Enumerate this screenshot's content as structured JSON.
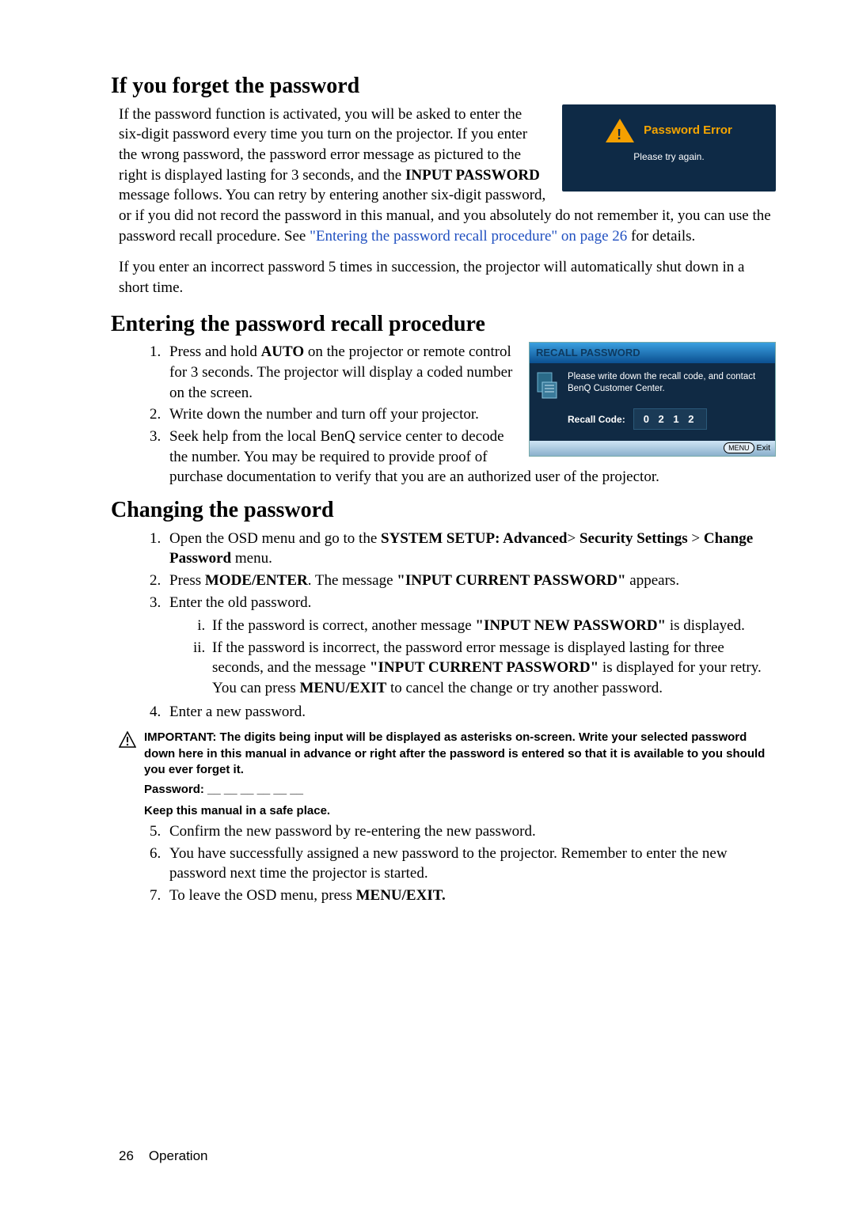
{
  "section1": {
    "heading": "If you forget the password",
    "para1a": "If the password function is activated, you will be asked to enter the six-digit password every time you turn on the projector. If you enter the wrong password, the password error message as pictured to the right is displayed lasting for 3 seconds, and the ",
    "para1b": "INPUT PASSWORD",
    "para1c": " message follows. You can retry by entering another six-digit password, or if you did not record the password in this manual, and you absolutely do not remember it, you can use the password recall procedure. See ",
    "link": "\"Entering the password recall procedure\" on page 26",
    "para1d": " for details.",
    "para2": "If you enter an incorrect password 5 times in succession, the projector will automatically shut down in a short time."
  },
  "err_box": {
    "title": "Password Error",
    "msg": "Please try again."
  },
  "section2": {
    "heading": "Entering the password recall procedure",
    "step1a": "Press and hold ",
    "step1b": "AUTO",
    "step1c": " on the projector or remote control for 3 seconds. The projector will display a coded number on the screen.",
    "step2": "Write down the number and turn off your projector.",
    "step3": "Seek help from the local BenQ service center to decode the number. You may be required to provide proof of purchase documentation to verify that you are an authorized user of the projector."
  },
  "recall_box": {
    "head": "RECALL PASSWORD",
    "text": "Please write down the recall code, and contact BenQ Customer Center.",
    "code_label": "Recall Code:",
    "code": "0 2 1 2",
    "foot_btn": "MENU",
    "foot_txt": "Exit"
  },
  "section3": {
    "heading": "Changing the password",
    "s1a": "Open the OSD menu and go to the ",
    "s1b": "SYSTEM SETUP: Advanced",
    "s1c": "> ",
    "s1d": "Security Settings",
    "s1e": " > ",
    "s1f": "Change Password",
    "s1g": " menu.",
    "s2a": "Press ",
    "s2b": "MODE/ENTER",
    "s2c": ". The message ",
    "s2d": "\"INPUT CURRENT PASSWORD\"",
    "s2e": " appears.",
    "s3": "Enter the old password.",
    "s3ia": "If the password is correct, another message ",
    "s3ib": "\"INPUT NEW PASSWORD\"",
    "s3ic": " is displayed.",
    "s3iia": "If the password is incorrect, the password error message is displayed lasting for three seconds, and the message ",
    "s3iib": "\"INPUT CURRENT PASSWORD\"",
    "s3iic": " is displayed for your retry. You can press ",
    "s3iid": "MENU/EXIT",
    "s3iie": " to cancel the change or try another password.",
    "s4": "Enter a new password.",
    "note": "IMPORTANT: The digits being input will be displayed as asterisks on-screen. Write your selected password down here in this manual in advance or right after the password is entered so that it is available to you should you ever forget it.",
    "pwd_line": "Password: __ __ __ __ __ __",
    "keep": "Keep this manual in a safe place.",
    "s5": "Confirm the new password by re-entering the new password.",
    "s6": "You have successfully assigned a new password to the projector. Remember to enter the new password next time the projector is started.",
    "s7a": "To leave the OSD menu, press ",
    "s7b": "MENU/EXIT."
  },
  "footer": {
    "page": "26",
    "label": "Operation"
  }
}
